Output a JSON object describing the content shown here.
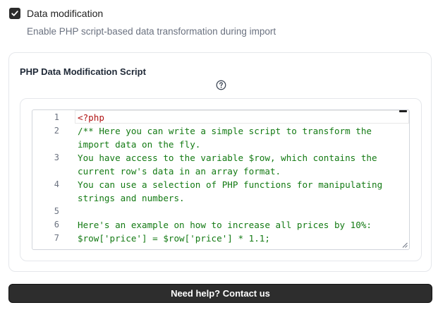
{
  "setting": {
    "checkbox_label": "Data modification",
    "checked": true,
    "helper_text": "Enable PHP script-based data transformation during import"
  },
  "card": {
    "title": "PHP Data Modification Script",
    "help_icon": "question-circle-icon"
  },
  "editor": {
    "lines": [
      {
        "num": "1",
        "text": "<?php"
      },
      {
        "num": "2",
        "text": "/** Here you can write a simple script to transform the\nimport data on the fly."
      },
      {
        "num": "3",
        "text": "You have access to the variable $row, which contains the\ncurrent row's data in an array format."
      },
      {
        "num": "4",
        "text": "You can use a selection of PHP functions for manipulating\nstrings and numbers."
      },
      {
        "num": "5",
        "text": ""
      },
      {
        "num": "6",
        "text": "Here's an example on how to increase all prices by 10%:"
      },
      {
        "num": "7",
        "text": "$row['price'] = $row['price'] * 1.1;"
      }
    ]
  },
  "footer": {
    "help_button_label": "Need help? Contact us"
  },
  "colors": {
    "code_comment": "#137a13",
    "php_tag": "#b01313",
    "button_bg": "#2d2d2d"
  }
}
